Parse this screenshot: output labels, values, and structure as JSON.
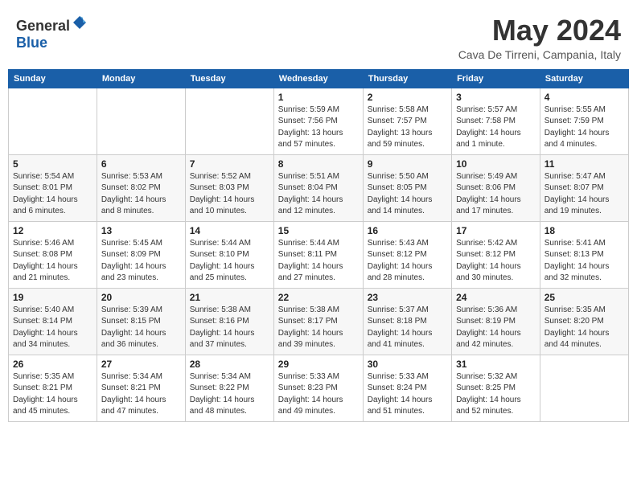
{
  "header": {
    "logo_general": "General",
    "logo_blue": "Blue",
    "title": "May 2024",
    "location": "Cava De Tirreni, Campania, Italy"
  },
  "calendar": {
    "days_of_week": [
      "Sunday",
      "Monday",
      "Tuesday",
      "Wednesday",
      "Thursday",
      "Friday",
      "Saturday"
    ],
    "weeks": [
      [
        {
          "day": "",
          "info": ""
        },
        {
          "day": "",
          "info": ""
        },
        {
          "day": "",
          "info": ""
        },
        {
          "day": "1",
          "info": "Sunrise: 5:59 AM\nSunset: 7:56 PM\nDaylight: 13 hours\nand 57 minutes."
        },
        {
          "day": "2",
          "info": "Sunrise: 5:58 AM\nSunset: 7:57 PM\nDaylight: 13 hours\nand 59 minutes."
        },
        {
          "day": "3",
          "info": "Sunrise: 5:57 AM\nSunset: 7:58 PM\nDaylight: 14 hours\nand 1 minute."
        },
        {
          "day": "4",
          "info": "Sunrise: 5:55 AM\nSunset: 7:59 PM\nDaylight: 14 hours\nand 4 minutes."
        }
      ],
      [
        {
          "day": "5",
          "info": "Sunrise: 5:54 AM\nSunset: 8:01 PM\nDaylight: 14 hours\nand 6 minutes."
        },
        {
          "day": "6",
          "info": "Sunrise: 5:53 AM\nSunset: 8:02 PM\nDaylight: 14 hours\nand 8 minutes."
        },
        {
          "day": "7",
          "info": "Sunrise: 5:52 AM\nSunset: 8:03 PM\nDaylight: 14 hours\nand 10 minutes."
        },
        {
          "day": "8",
          "info": "Sunrise: 5:51 AM\nSunset: 8:04 PM\nDaylight: 14 hours\nand 12 minutes."
        },
        {
          "day": "9",
          "info": "Sunrise: 5:50 AM\nSunset: 8:05 PM\nDaylight: 14 hours\nand 14 minutes."
        },
        {
          "day": "10",
          "info": "Sunrise: 5:49 AM\nSunset: 8:06 PM\nDaylight: 14 hours\nand 17 minutes."
        },
        {
          "day": "11",
          "info": "Sunrise: 5:47 AM\nSunset: 8:07 PM\nDaylight: 14 hours\nand 19 minutes."
        }
      ],
      [
        {
          "day": "12",
          "info": "Sunrise: 5:46 AM\nSunset: 8:08 PM\nDaylight: 14 hours\nand 21 minutes."
        },
        {
          "day": "13",
          "info": "Sunrise: 5:45 AM\nSunset: 8:09 PM\nDaylight: 14 hours\nand 23 minutes."
        },
        {
          "day": "14",
          "info": "Sunrise: 5:44 AM\nSunset: 8:10 PM\nDaylight: 14 hours\nand 25 minutes."
        },
        {
          "day": "15",
          "info": "Sunrise: 5:44 AM\nSunset: 8:11 PM\nDaylight: 14 hours\nand 27 minutes."
        },
        {
          "day": "16",
          "info": "Sunrise: 5:43 AM\nSunset: 8:12 PM\nDaylight: 14 hours\nand 28 minutes."
        },
        {
          "day": "17",
          "info": "Sunrise: 5:42 AM\nSunset: 8:12 PM\nDaylight: 14 hours\nand 30 minutes."
        },
        {
          "day": "18",
          "info": "Sunrise: 5:41 AM\nSunset: 8:13 PM\nDaylight: 14 hours\nand 32 minutes."
        }
      ],
      [
        {
          "day": "19",
          "info": "Sunrise: 5:40 AM\nSunset: 8:14 PM\nDaylight: 14 hours\nand 34 minutes."
        },
        {
          "day": "20",
          "info": "Sunrise: 5:39 AM\nSunset: 8:15 PM\nDaylight: 14 hours\nand 36 minutes."
        },
        {
          "day": "21",
          "info": "Sunrise: 5:38 AM\nSunset: 8:16 PM\nDaylight: 14 hours\nand 37 minutes."
        },
        {
          "day": "22",
          "info": "Sunrise: 5:38 AM\nSunset: 8:17 PM\nDaylight: 14 hours\nand 39 minutes."
        },
        {
          "day": "23",
          "info": "Sunrise: 5:37 AM\nSunset: 8:18 PM\nDaylight: 14 hours\nand 41 minutes."
        },
        {
          "day": "24",
          "info": "Sunrise: 5:36 AM\nSunset: 8:19 PM\nDaylight: 14 hours\nand 42 minutes."
        },
        {
          "day": "25",
          "info": "Sunrise: 5:35 AM\nSunset: 8:20 PM\nDaylight: 14 hours\nand 44 minutes."
        }
      ],
      [
        {
          "day": "26",
          "info": "Sunrise: 5:35 AM\nSunset: 8:21 PM\nDaylight: 14 hours\nand 45 minutes."
        },
        {
          "day": "27",
          "info": "Sunrise: 5:34 AM\nSunset: 8:21 PM\nDaylight: 14 hours\nand 47 minutes."
        },
        {
          "day": "28",
          "info": "Sunrise: 5:34 AM\nSunset: 8:22 PM\nDaylight: 14 hours\nand 48 minutes."
        },
        {
          "day": "29",
          "info": "Sunrise: 5:33 AM\nSunset: 8:23 PM\nDaylight: 14 hours\nand 49 minutes."
        },
        {
          "day": "30",
          "info": "Sunrise: 5:33 AM\nSunset: 8:24 PM\nDaylight: 14 hours\nand 51 minutes."
        },
        {
          "day": "31",
          "info": "Sunrise: 5:32 AM\nSunset: 8:25 PM\nDaylight: 14 hours\nand 52 minutes."
        },
        {
          "day": "",
          "info": ""
        }
      ]
    ]
  }
}
